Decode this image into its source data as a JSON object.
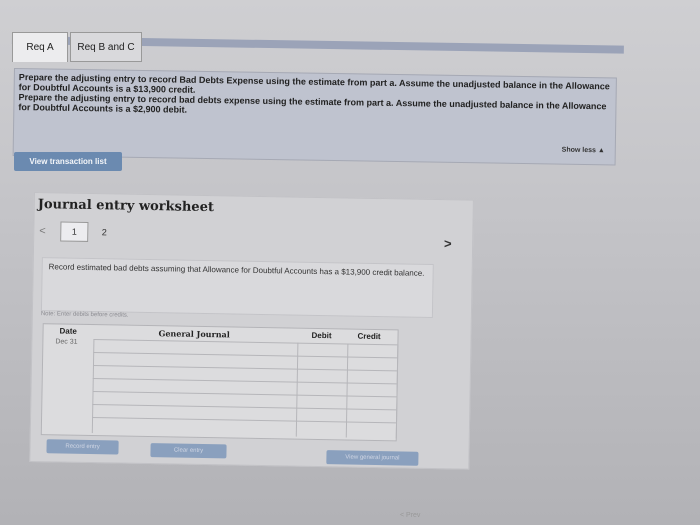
{
  "tabs": [
    {
      "label": "Req A"
    },
    {
      "label": "Req B and C"
    }
  ],
  "instructions": {
    "line1": "Prepare the adjusting entry to record Bad Debts Expense using the estimate from part a. Assume the unadjusted balance in the Allowance for Doubtful Accounts is a $13,900 credit.",
    "line2": "Prepare the adjusting entry to record bad debts expense using the estimate from part a. Assume the unadjusted balance in the Allowance for Doubtful Accounts is a $2,900 debit.",
    "show_less": "Show less ▲"
  },
  "view_transaction_list": "View transaction list",
  "worksheet": {
    "title": "Journal entry worksheet",
    "nav_prev": "<",
    "pages": [
      "1",
      "2"
    ],
    "nav_next": ">",
    "description": "Record estimated bad debts assuming that Allowance for Doubtful Accounts has a $13,900 credit balance.",
    "note": "Note: Enter debits before credits.",
    "table": {
      "headers": {
        "date": "Date",
        "general_journal": "General Journal",
        "debit": "Debit",
        "credit": "Credit"
      },
      "first_date": "Dec 31"
    },
    "buttons": {
      "record": "Record entry",
      "clear": "Clear entry",
      "view_journal": "View general journal"
    }
  },
  "footer": {
    "prev": "< Prev"
  }
}
